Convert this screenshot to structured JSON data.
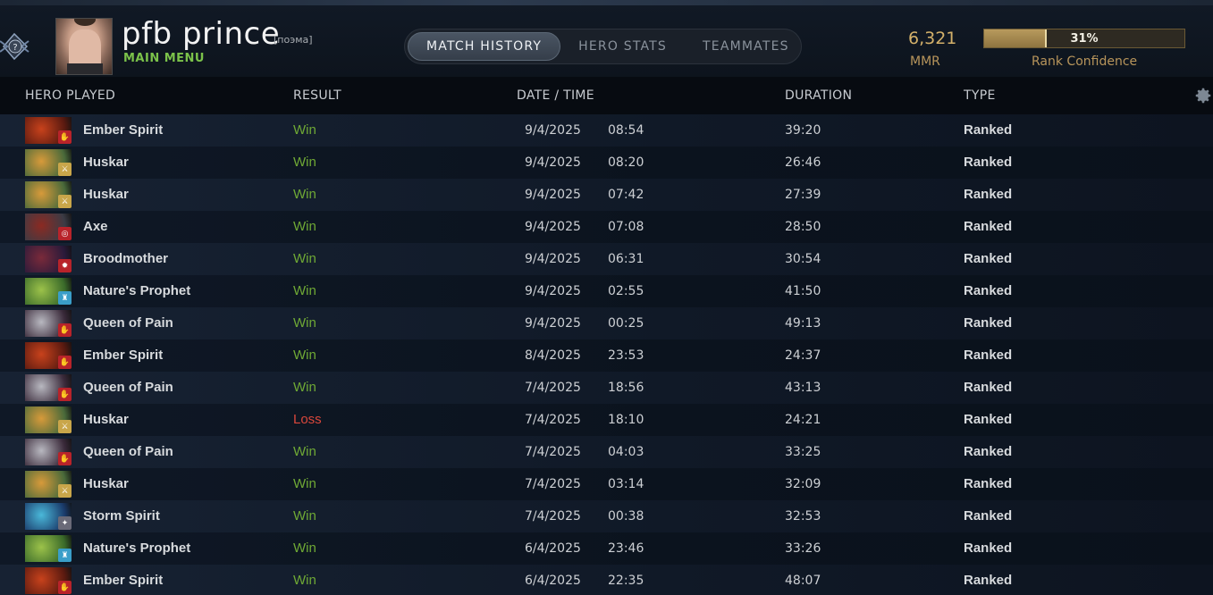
{
  "player": {
    "name": "pfb prince",
    "tag": "[поэма]",
    "main_menu_label": "MAIN MENU"
  },
  "tabs": [
    {
      "label": "MATCH HISTORY",
      "active": true
    },
    {
      "label": "HERO STATS",
      "active": false
    },
    {
      "label": "TEAMMATES",
      "active": false
    }
  ],
  "mmr": {
    "value": "6,321",
    "label": "MMR"
  },
  "rank_confidence": {
    "value_text": "31%",
    "fraction": 0.31,
    "label": "Rank Confidence"
  },
  "columns": {
    "hero": "HERO PLAYED",
    "result": "RESULT",
    "datetime": "DATE / TIME",
    "duration": "DURATION",
    "type": "TYPE"
  },
  "colors": {
    "win": "#6fa935",
    "loss": "#d9473b",
    "accent_gold": "#d4b16a",
    "main_menu": "#7bc24a"
  },
  "heroes": {
    "Ember Spirit": {
      "c1": "#c8421c",
      "c2": "#5a1a10",
      "role_color": "#b8232a",
      "role_icon": "hand-icon",
      "role_glyph": "✋"
    },
    "Huskar": {
      "c1": "#d79a3a",
      "c2": "#4a6a3a",
      "role_color": "#c9a64a",
      "role_icon": "sword-icon",
      "role_glyph": "⚔"
    },
    "Axe": {
      "c1": "#8b2a22",
      "c2": "#3b3b45",
      "role_color": "#b8232a",
      "role_icon": "target-icon",
      "role_glyph": "◎"
    },
    "Broodmother": {
      "c1": "#7a2a3a",
      "c2": "#2a1a3a",
      "role_color": "#b8232a",
      "role_icon": "spider-icon",
      "role_glyph": "✹"
    },
    "Nature's Prophet": {
      "c1": "#9cc24a",
      "c2": "#3a6a2a",
      "role_color": "#3a9ec9",
      "role_icon": "tower-icon",
      "role_glyph": "♜"
    },
    "Queen of Pain": {
      "c1": "#b8b8c0",
      "c2": "#3a2a3a",
      "role_color": "#b8232a",
      "role_icon": "hand-icon",
      "role_glyph": "✋"
    },
    "Storm Spirit": {
      "c1": "#4ab8d9",
      "c2": "#1a3a6a",
      "role_color": "#6a6a78",
      "role_icon": "runner-icon",
      "role_glyph": "✦"
    }
  },
  "matches": [
    {
      "hero": "Ember Spirit",
      "result": "Win",
      "date": "9/4/2025",
      "time": "08:54",
      "duration": "39:20",
      "type": "Ranked"
    },
    {
      "hero": "Huskar",
      "result": "Win",
      "date": "9/4/2025",
      "time": "08:20",
      "duration": "26:46",
      "type": "Ranked"
    },
    {
      "hero": "Huskar",
      "result": "Win",
      "date": "9/4/2025",
      "time": "07:42",
      "duration": "27:39",
      "type": "Ranked"
    },
    {
      "hero": "Axe",
      "result": "Win",
      "date": "9/4/2025",
      "time": "07:08",
      "duration": "28:50",
      "type": "Ranked"
    },
    {
      "hero": "Broodmother",
      "result": "Win",
      "date": "9/4/2025",
      "time": "06:31",
      "duration": "30:54",
      "type": "Ranked"
    },
    {
      "hero": "Nature's Prophet",
      "result": "Win",
      "date": "9/4/2025",
      "time": "02:55",
      "duration": "41:50",
      "type": "Ranked"
    },
    {
      "hero": "Queen of Pain",
      "result": "Win",
      "date": "9/4/2025",
      "time": "00:25",
      "duration": "49:13",
      "type": "Ranked"
    },
    {
      "hero": "Ember Spirit",
      "result": "Win",
      "date": "8/4/2025",
      "time": "23:53",
      "duration": "24:37",
      "type": "Ranked"
    },
    {
      "hero": "Queen of Pain",
      "result": "Win",
      "date": "7/4/2025",
      "time": "18:56",
      "duration": "43:13",
      "type": "Ranked"
    },
    {
      "hero": "Huskar",
      "result": "Loss",
      "date": "7/4/2025",
      "time": "18:10",
      "duration": "24:21",
      "type": "Ranked"
    },
    {
      "hero": "Queen of Pain",
      "result": "Win",
      "date": "7/4/2025",
      "time": "04:03",
      "duration": "33:25",
      "type": "Ranked"
    },
    {
      "hero": "Huskar",
      "result": "Win",
      "date": "7/4/2025",
      "time": "03:14",
      "duration": "32:09",
      "type": "Ranked"
    },
    {
      "hero": "Storm Spirit",
      "result": "Win",
      "date": "7/4/2025",
      "time": "00:38",
      "duration": "32:53",
      "type": "Ranked"
    },
    {
      "hero": "Nature's Prophet",
      "result": "Win",
      "date": "6/4/2025",
      "time": "23:46",
      "duration": "33:26",
      "type": "Ranked"
    },
    {
      "hero": "Ember Spirit",
      "result": "Win",
      "date": "6/4/2025",
      "time": "22:35",
      "duration": "48:07",
      "type": "Ranked"
    }
  ]
}
